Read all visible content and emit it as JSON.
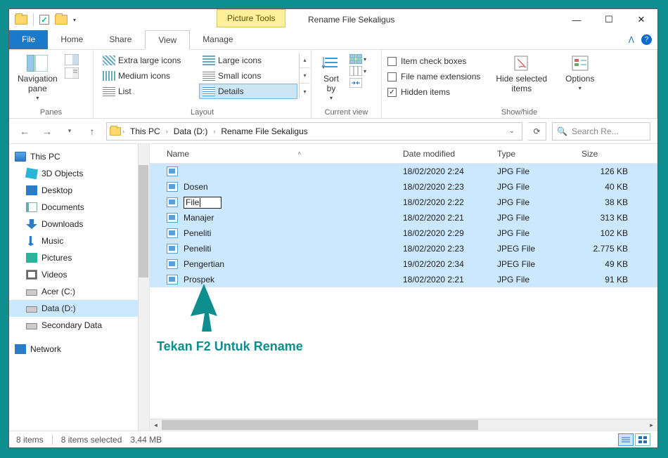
{
  "window": {
    "title": "Rename File Sekaligus",
    "context_tab": "Picture Tools"
  },
  "tabs": {
    "file": "File",
    "home": "Home",
    "share": "Share",
    "view": "View",
    "manage": "Manage"
  },
  "ribbon": {
    "panes": {
      "label": "Panes",
      "nav": "Navigation\npane"
    },
    "layout": {
      "label": "Layout",
      "xl": "Extra large icons",
      "lg": "Large icons",
      "md": "Medium icons",
      "sm": "Small icons",
      "list": "List",
      "details": "Details"
    },
    "current_view": {
      "label": "Current view",
      "sort": "Sort\nby"
    },
    "show_hide": {
      "label": "Show/hide",
      "item_check": "Item check boxes",
      "ext": "File name extensions",
      "hidden": "Hidden items",
      "hide_btn": "Hide selected\nitems",
      "options": "Options"
    }
  },
  "breadcrumb": {
    "seg1": "This PC",
    "seg2": "Data (D:)",
    "seg3": "Rename File Sekaligus",
    "search_placeholder": "Search Re..."
  },
  "sidebar": {
    "this_pc": "This PC",
    "objects3d": "3D Objects",
    "desktop": "Desktop",
    "documents": "Documents",
    "downloads": "Downloads",
    "music": "Music",
    "pictures": "Pictures",
    "videos": "Videos",
    "acer": "Acer (C:)",
    "data": "Data  (D:)",
    "secondary": "Secondary Data",
    "network": "Network"
  },
  "columns": {
    "name": "Name",
    "date": "Date modified",
    "type": "Type",
    "size": "Size"
  },
  "files": [
    {
      "name": "",
      "date": "18/02/2020 2:24",
      "type": "JPG File",
      "size": "126 KB"
    },
    {
      "name": "Dosen",
      "date": "18/02/2020 2:23",
      "type": "JPG File",
      "size": "40 KB"
    },
    {
      "name": "File",
      "date": "18/02/2020 2:22",
      "type": "JPG File",
      "size": "38 KB",
      "editing": true
    },
    {
      "name": "Manajer",
      "date": "18/02/2020 2:21",
      "type": "JPG File",
      "size": "313 KB"
    },
    {
      "name": "Peneliti",
      "date": "18/02/2020 2:29",
      "type": "JPG File",
      "size": "102 KB"
    },
    {
      "name": "Peneliti",
      "date": "18/02/2020 2:23",
      "type": "JPEG File",
      "size": "2.775 KB"
    },
    {
      "name": "Pengertian",
      "date": "19/02/2020 2:34",
      "type": "JPEG File",
      "size": "49 KB"
    },
    {
      "name": "Prospek",
      "date": "18/02/2020 2:21",
      "type": "JPG File",
      "size": "91 KB"
    }
  ],
  "status": {
    "count": "8 items",
    "selected": "8 items selected",
    "size": "3,44 MB"
  },
  "annotation": "Tekan F2 Untuk Rename"
}
